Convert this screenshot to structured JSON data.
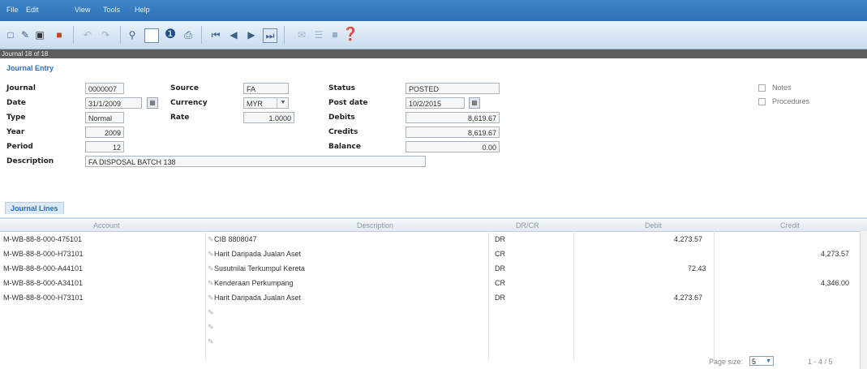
{
  "menu": [
    "File",
    "Edit",
    "View",
    "Tools",
    "Help"
  ],
  "record_bar": "Journal 18 of 18",
  "section_title": "Journal Entry",
  "form": {
    "journal_label": "Journal",
    "journal_value": "0000007",
    "date_label": "Date",
    "date_value": "31/1/2009",
    "type_label": "Type",
    "type_value": "Normal",
    "year_label": "Year",
    "year_value": "2009",
    "period_label": "Period",
    "period_value": "12",
    "description_label": "Description",
    "description_value": "FA DISPOSAL BATCH 138",
    "source_label": "Source",
    "source_value": "FA",
    "currency_label": "Currency",
    "currency_value": "MYR",
    "rate_label": "Rate",
    "rate_value": "1.0000",
    "status_label": "Status",
    "status_value": "POSTED",
    "post_date_label": "Post date",
    "post_date_value": "10/2/2015",
    "debits_label": "Debits",
    "debits_value": "8,619.67",
    "credits_label": "Credits",
    "credits_value": "8,619.67",
    "balance_label": "Balance",
    "balance_value": "0.00"
  },
  "options": {
    "notes_label": "Notes",
    "procedures_label": "Procedures"
  },
  "tab_label": "Journal Lines",
  "grid": {
    "headers": [
      "Account",
      "Description",
      "DR/CR",
      "Debit",
      "Credit"
    ],
    "rows": [
      {
        "account": "M-WB-88-8-000-475101",
        "description": "CIB 8808047",
        "drcr": "DR",
        "debit": "4,273.57",
        "credit": ""
      },
      {
        "account": "M-WB-88-8-000-H73101",
        "description": "Harit Daripada Jualan Aset",
        "drcr": "CR",
        "debit": "",
        "credit": "4,273.57"
      },
      {
        "account": "M-WB-88-8-000-A44101",
        "description": "Susutnilai Terkumpul Kereta",
        "drcr": "DR",
        "debit": "72.43",
        "credit": ""
      },
      {
        "account": "M-WB-88-8-000-A34101",
        "description": "Kenderaan Perkumpang",
        "drcr": "CR",
        "debit": "",
        "credit": "4,346.00"
      },
      {
        "account": "M-WB-88-8-000-H73101",
        "description": "Harit Daripada Jualan Aset",
        "drcr": "DR",
        "debit": "4,273.67",
        "credit": ""
      }
    ]
  },
  "pager": {
    "label": "Page size:",
    "size": "5",
    "count": "1 - 4 / 5"
  },
  "colors": {
    "menubar": "#2e6fb3",
    "accent": "#2a6ebb",
    "record_bar": "#5d5d5d"
  }
}
